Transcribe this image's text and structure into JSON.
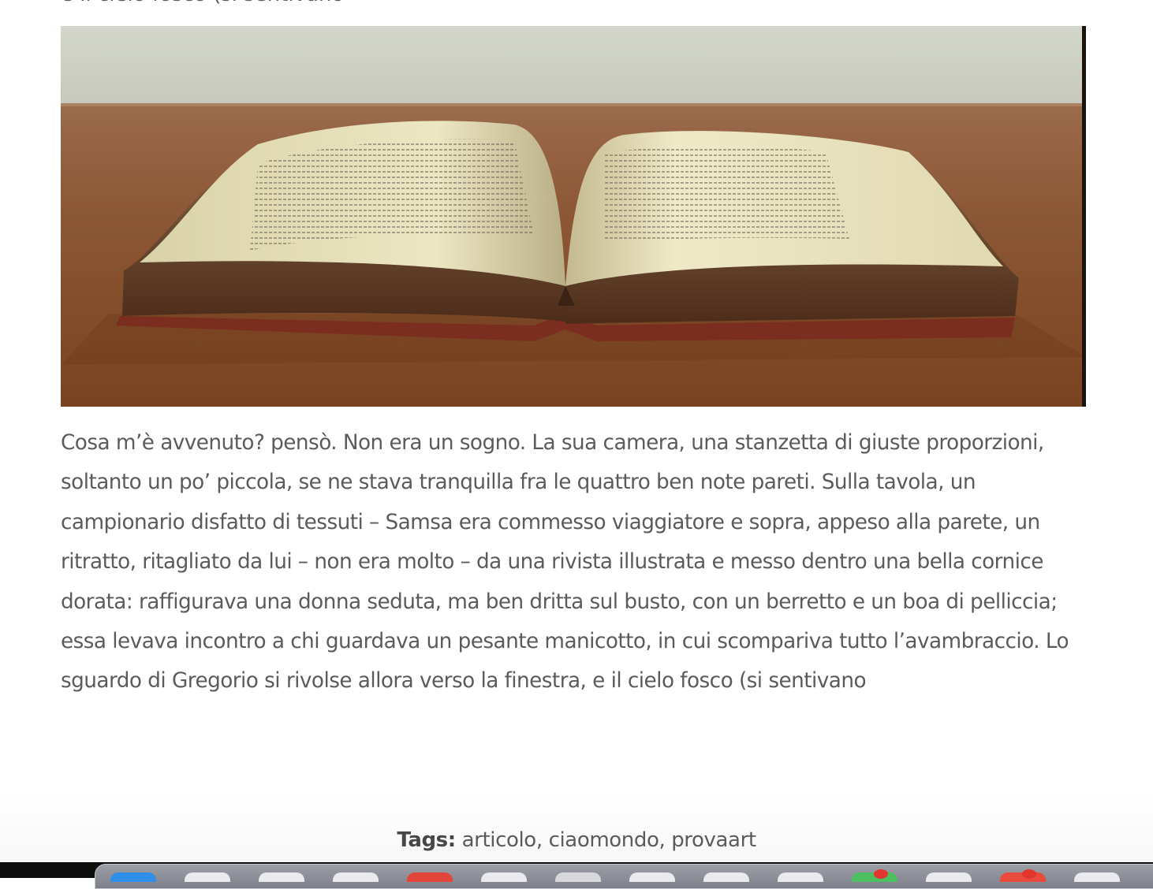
{
  "article": {
    "previous_line": "e il cielo fosco (si sentivano",
    "image_alt": "Libro aperto su un tavolo di legno",
    "body": "Cosa m’è avvenuto? pensò. Non era un sogno. La sua camera, una stanzetta di giuste proporzioni, soltanto un po’ piccola, se ne stava tranquilla fra le quattro ben note pareti. Sulla tavola, un campionario disfatto di tessuti – Samsa era commesso viaggiatore e sopra, appeso alla parete, un ritratto, ritagliato da lui – non era molto – da una rivista illustrata e messo dentro una bella cornice dorata: raffigurava una donna seduta, ma ben dritta sul busto, con un berretto e un boa di pelliccia; essa levava incontro a chi guardava un pesante manicotto, in cui scompariva tutto l’avambraccio. Lo sguardo di Gregorio si rivolse allora verso la finestra, e il cielo fosco (si sentivano"
  },
  "tags": {
    "label": "Tags:",
    "items": [
      {
        "text": "articolo",
        "sep": ", "
      },
      {
        "text": "ciaomondo",
        "sep": ", "
      },
      {
        "text": "provaart",
        "sep": ""
      }
    ]
  },
  "dock": {
    "apps": [
      {
        "name": "finder",
        "color": "#2f8fe8",
        "badge": false
      },
      {
        "name": "app-2",
        "color": "#e9e9ee",
        "badge": false
      },
      {
        "name": "app-3",
        "color": "#e9e9ee",
        "badge": false
      },
      {
        "name": "app-4",
        "color": "#e9e9ee",
        "badge": false
      },
      {
        "name": "app-5",
        "color": "#e2463b",
        "badge": false
      },
      {
        "name": "app-6",
        "color": "#e9e9ee",
        "badge": false
      },
      {
        "name": "app-7",
        "color": "#d7d7dc",
        "badge": false
      },
      {
        "name": "app-8",
        "color": "#e9e9ee",
        "badge": false
      },
      {
        "name": "app-9",
        "color": "#e9e9ee",
        "badge": false
      },
      {
        "name": "app-10",
        "color": "#e9e9ee",
        "badge": false
      },
      {
        "name": "app-11",
        "color": "#4cc060",
        "badge": true
      },
      {
        "name": "app-12",
        "color": "#e9e9ee",
        "badge": false
      },
      {
        "name": "app-13",
        "color": "#e84a3c",
        "badge": true
      },
      {
        "name": "app-14",
        "color": "#e9e9ee",
        "badge": false
      }
    ]
  }
}
